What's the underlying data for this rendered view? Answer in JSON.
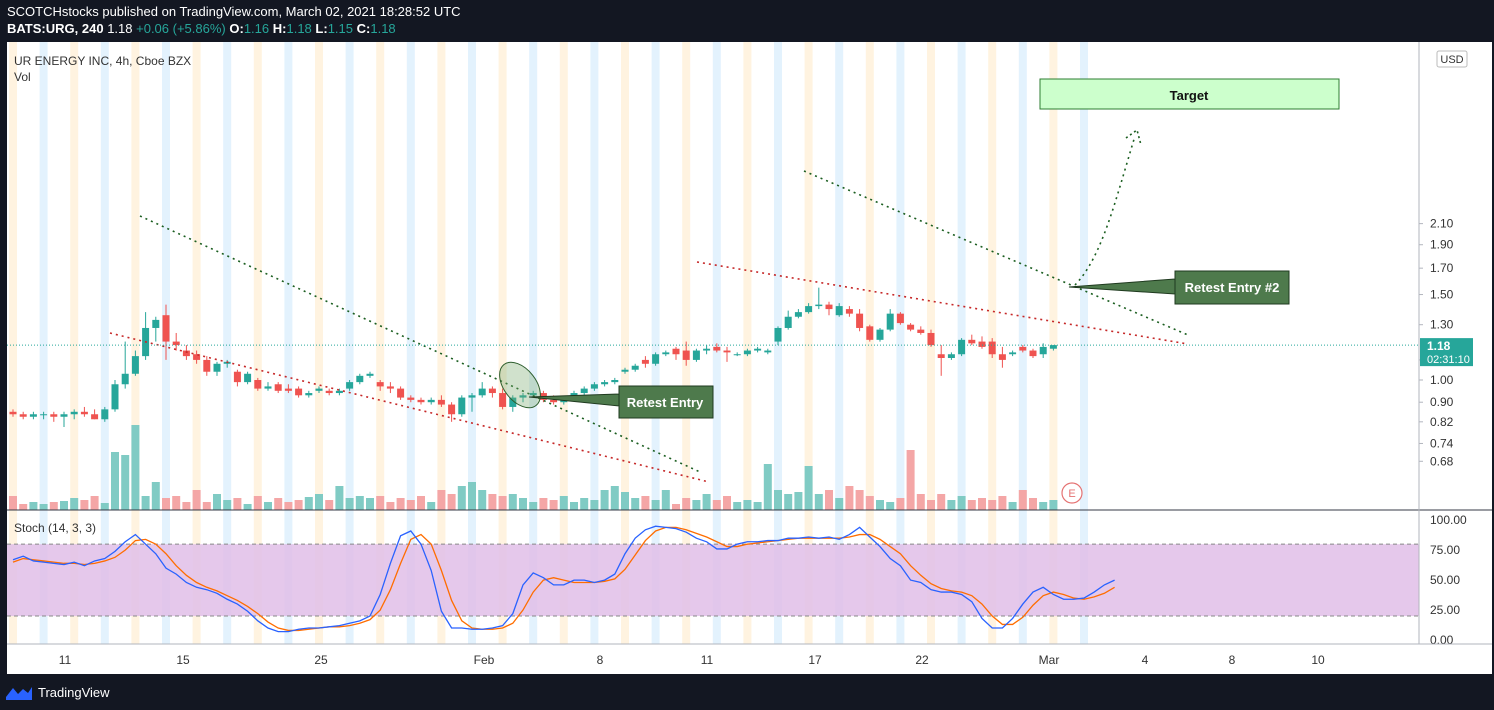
{
  "header": {
    "line1": "SCOTCHstocks published on TradingView.com, March 02, 2021 18:28:52 UTC",
    "symbol": "BATS:URG, 240",
    "last": "1.18",
    "change": "+0.06 (+5.86%)",
    "o_label": "O:",
    "o": "1.16",
    "h_label": "H:",
    "h": "1.18",
    "l_label": "L:",
    "l": "1.15",
    "c_label": "C:",
    "c": "1.18"
  },
  "legend": {
    "title": "UR ENERGY INC, 4h, Cboe BZX",
    "vol": "Vol",
    "stoch": "Stoch (14, 3, 3)"
  },
  "currency": "USD",
  "price_badge": {
    "price": "1.18",
    "countdown": "02:31:10"
  },
  "annotations": {
    "target": "Target",
    "retest1": "Retest Entry",
    "retest2": "Retest Entry #2",
    "earnings": "E"
  },
  "footer": {
    "brand": "TradingView"
  },
  "colors": {
    "up": "#26a69a",
    "down": "#ef5350",
    "stoch_k": "#2962ff",
    "stoch_d": "#ff6d00",
    "band": "#e1bee7",
    "target_fill": "#ccffcc"
  },
  "chart_data": {
    "type": "candlestick",
    "x_ticks": [
      "11",
      "15",
      "25",
      "Feb",
      "8",
      "11",
      "17",
      "22",
      "Mar",
      "4",
      "8",
      "10"
    ],
    "y_ticks": [
      "2.10",
      "1.90",
      "1.70",
      "1.50",
      "1.30",
      "1.18",
      "1.10",
      "1.00",
      "0.90",
      "0.82",
      "0.74",
      "0.68"
    ],
    "y_scale": "log",
    "stoch_ticks": [
      "100.00",
      "75.00",
      "50.00",
      "25.00",
      "0.00"
    ],
    "stoch_band": [
      20,
      80
    ],
    "last_price": 1.18,
    "candles": [
      {
        "o": 0.86,
        "h": 0.87,
        "l": 0.84,
        "c": 0.85
      },
      {
        "o": 0.85,
        "h": 0.86,
        "l": 0.83,
        "c": 0.84
      },
      {
        "o": 0.84,
        "h": 0.86,
        "l": 0.83,
        "c": 0.85
      },
      {
        "o": 0.85,
        "h": 0.86,
        "l": 0.83,
        "c": 0.85
      },
      {
        "o": 0.85,
        "h": 0.86,
        "l": 0.82,
        "c": 0.84
      },
      {
        "o": 0.84,
        "h": 0.86,
        "l": 0.8,
        "c": 0.85
      },
      {
        "o": 0.85,
        "h": 0.87,
        "l": 0.83,
        "c": 0.86
      },
      {
        "o": 0.86,
        "h": 0.88,
        "l": 0.84,
        "c": 0.85
      },
      {
        "o": 0.85,
        "h": 0.87,
        "l": 0.83,
        "c": 0.83
      },
      {
        "o": 0.83,
        "h": 0.88,
        "l": 0.82,
        "c": 0.87
      },
      {
        "o": 0.87,
        "h": 1.0,
        "l": 0.86,
        "c": 0.98
      },
      {
        "o": 0.98,
        "h": 1.2,
        "l": 0.96,
        "c": 1.03
      },
      {
        "o": 1.03,
        "h": 1.15,
        "l": 1.02,
        "c": 1.12
      },
      {
        "o": 1.12,
        "h": 1.38,
        "l": 1.1,
        "c": 1.28
      },
      {
        "o": 1.28,
        "h": 1.35,
        "l": 1.2,
        "c": 1.33
      },
      {
        "o": 1.36,
        "h": 1.43,
        "l": 1.1,
        "c": 1.2
      },
      {
        "o": 1.2,
        "h": 1.25,
        "l": 1.15,
        "c": 1.18
      },
      {
        "o": 1.15,
        "h": 1.18,
        "l": 1.1,
        "c": 1.12
      },
      {
        "o": 1.13,
        "h": 1.15,
        "l": 1.08,
        "c": 1.1
      },
      {
        "o": 1.1,
        "h": 1.12,
        "l": 1.02,
        "c": 1.04
      },
      {
        "o": 1.04,
        "h": 1.09,
        "l": 1.02,
        "c": 1.08
      },
      {
        "o": 1.08,
        "h": 1.1,
        "l": 1.06,
        "c": 1.09
      },
      {
        "o": 1.04,
        "h": 1.05,
        "l": 0.97,
        "c": 0.99
      },
      {
        "o": 0.99,
        "h": 1.04,
        "l": 0.98,
        "c": 1.03
      },
      {
        "o": 1.0,
        "h": 1.01,
        "l": 0.95,
        "c": 0.96
      },
      {
        "o": 0.96,
        "h": 0.99,
        "l": 0.95,
        "c": 0.97
      },
      {
        "o": 0.98,
        "h": 0.99,
        "l": 0.94,
        "c": 0.95
      },
      {
        "o": 0.96,
        "h": 0.98,
        "l": 0.94,
        "c": 0.95
      },
      {
        "o": 0.96,
        "h": 0.97,
        "l": 0.92,
        "c": 0.93
      },
      {
        "o": 0.93,
        "h": 0.95,
        "l": 0.92,
        "c": 0.94
      },
      {
        "o": 0.95,
        "h": 0.97,
        "l": 0.94,
        "c": 0.96
      },
      {
        "o": 0.95,
        "h": 0.96,
        "l": 0.93,
        "c": 0.94
      },
      {
        "o": 0.94,
        "h": 0.96,
        "l": 0.93,
        "c": 0.95
      },
      {
        "o": 0.96,
        "h": 1.0,
        "l": 0.95,
        "c": 0.99
      },
      {
        "o": 0.99,
        "h": 1.03,
        "l": 0.98,
        "c": 1.02
      },
      {
        "o": 1.02,
        "h": 1.04,
        "l": 1.01,
        "c": 1.03
      },
      {
        "o": 0.99,
        "h": 1.0,
        "l": 0.95,
        "c": 0.97
      },
      {
        "o": 0.97,
        "h": 0.99,
        "l": 0.94,
        "c": 0.96
      },
      {
        "o": 0.96,
        "h": 0.97,
        "l": 0.91,
        "c": 0.92
      },
      {
        "o": 0.92,
        "h": 0.93,
        "l": 0.9,
        "c": 0.91
      },
      {
        "o": 0.91,
        "h": 0.92,
        "l": 0.89,
        "c": 0.9
      },
      {
        "o": 0.9,
        "h": 0.92,
        "l": 0.89,
        "c": 0.91
      },
      {
        "o": 0.91,
        "h": 0.93,
        "l": 0.88,
        "c": 0.89
      },
      {
        "o": 0.89,
        "h": 0.9,
        "l": 0.82,
        "c": 0.85
      },
      {
        "o": 0.85,
        "h": 0.93,
        "l": 0.84,
        "c": 0.92
      },
      {
        "o": 0.92,
        "h": 0.94,
        "l": 0.86,
        "c": 0.93
      },
      {
        "o": 0.93,
        "h": 0.99,
        "l": 0.92,
        "c": 0.96
      },
      {
        "o": 0.96,
        "h": 0.97,
        "l": 0.92,
        "c": 0.94
      },
      {
        "o": 0.94,
        "h": 0.96,
        "l": 0.87,
        "c": 0.88
      },
      {
        "o": 0.88,
        "h": 0.93,
        "l": 0.86,
        "c": 0.92
      },
      {
        "o": 0.92,
        "h": 0.94,
        "l": 0.9,
        "c": 0.93
      },
      {
        "o": 0.93,
        "h": 0.95,
        "l": 0.92,
        "c": 0.94
      },
      {
        "o": 0.94,
        "h": 0.95,
        "l": 0.9,
        "c": 0.91
      },
      {
        "o": 0.91,
        "h": 0.93,
        "l": 0.89,
        "c": 0.9
      },
      {
        "o": 0.9,
        "h": 0.92,
        "l": 0.89,
        "c": 0.91
      },
      {
        "o": 0.92,
        "h": 0.95,
        "l": 0.91,
        "c": 0.94
      },
      {
        "o": 0.94,
        "h": 0.97,
        "l": 0.93,
        "c": 0.96
      },
      {
        "o": 0.96,
        "h": 0.99,
        "l": 0.95,
        "c": 0.98
      },
      {
        "o": 0.98,
        "h": 1.0,
        "l": 0.97,
        "c": 0.99
      },
      {
        "o": 0.99,
        "h": 1.01,
        "l": 0.98,
        "c": 1.0
      },
      {
        "o": 1.04,
        "h": 1.06,
        "l": 1.03,
        "c": 1.05
      },
      {
        "o": 1.05,
        "h": 1.08,
        "l": 1.04,
        "c": 1.07
      },
      {
        "o": 1.1,
        "h": 1.12,
        "l": 1.06,
        "c": 1.08
      },
      {
        "o": 1.08,
        "h": 1.14,
        "l": 1.07,
        "c": 1.13
      },
      {
        "o": 1.13,
        "h": 1.15,
        "l": 1.12,
        "c": 1.14
      },
      {
        "o": 1.16,
        "h": 1.17,
        "l": 1.1,
        "c": 1.13
      },
      {
        "o": 1.15,
        "h": 1.2,
        "l": 1.07,
        "c": 1.1
      },
      {
        "o": 1.1,
        "h": 1.16,
        "l": 1.09,
        "c": 1.15
      },
      {
        "o": 1.15,
        "h": 1.18,
        "l": 1.13,
        "c": 1.16
      },
      {
        "o": 1.17,
        "h": 1.19,
        "l": 1.14,
        "c": 1.15
      },
      {
        "o": 1.15,
        "h": 1.17,
        "l": 1.09,
        "c": 1.14
      },
      {
        "o": 1.13,
        "h": 1.14,
        "l": 1.12,
        "c": 1.13
      },
      {
        "o": 1.13,
        "h": 1.16,
        "l": 1.12,
        "c": 1.15
      },
      {
        "o": 1.15,
        "h": 1.17,
        "l": 1.14,
        "c": 1.16
      },
      {
        "o": 1.14,
        "h": 1.16,
        "l": 1.13,
        "c": 1.15
      },
      {
        "o": 1.2,
        "h": 1.29,
        "l": 1.18,
        "c": 1.28
      },
      {
        "o": 1.28,
        "h": 1.39,
        "l": 1.27,
        "c": 1.35
      },
      {
        "o": 1.35,
        "h": 1.4,
        "l": 1.34,
        "c": 1.38
      },
      {
        "o": 1.38,
        "h": 1.44,
        "l": 1.37,
        "c": 1.42
      },
      {
        "o": 1.42,
        "h": 1.55,
        "l": 1.4,
        "c": 1.43
      },
      {
        "o": 1.43,
        "h": 1.45,
        "l": 1.36,
        "c": 1.4
      },
      {
        "o": 1.36,
        "h": 1.44,
        "l": 1.35,
        "c": 1.42
      },
      {
        "o": 1.4,
        "h": 1.42,
        "l": 1.35,
        "c": 1.37
      },
      {
        "o": 1.37,
        "h": 1.4,
        "l": 1.26,
        "c": 1.28
      },
      {
        "o": 1.29,
        "h": 1.3,
        "l": 1.2,
        "c": 1.21
      },
      {
        "o": 1.21,
        "h": 1.28,
        "l": 1.2,
        "c": 1.27
      },
      {
        "o": 1.27,
        "h": 1.4,
        "l": 1.26,
        "c": 1.37
      },
      {
        "o": 1.37,
        "h": 1.38,
        "l": 1.3,
        "c": 1.31
      },
      {
        "o": 1.3,
        "h": 1.31,
        "l": 1.26,
        "c": 1.27
      },
      {
        "o": 1.27,
        "h": 1.29,
        "l": 1.24,
        "c": 1.25
      },
      {
        "o": 1.25,
        "h": 1.27,
        "l": 1.17,
        "c": 1.18
      },
      {
        "o": 1.13,
        "h": 1.18,
        "l": 1.02,
        "c": 1.11
      },
      {
        "o": 1.11,
        "h": 1.14,
        "l": 1.1,
        "c": 1.13
      },
      {
        "o": 1.13,
        "h": 1.22,
        "l": 1.12,
        "c": 1.21
      },
      {
        "o": 1.21,
        "h": 1.24,
        "l": 1.18,
        "c": 1.19
      },
      {
        "o": 1.2,
        "h": 1.23,
        "l": 1.16,
        "c": 1.17
      },
      {
        "o": 1.2,
        "h": 1.22,
        "l": 1.11,
        "c": 1.13
      },
      {
        "o": 1.13,
        "h": 1.17,
        "l": 1.06,
        "c": 1.1
      },
      {
        "o": 1.13,
        "h": 1.15,
        "l": 1.12,
        "c": 1.14
      },
      {
        "o": 1.17,
        "h": 1.18,
        "l": 1.14,
        "c": 1.15
      },
      {
        "o": 1.15,
        "h": 1.16,
        "l": 1.11,
        "c": 1.12
      },
      {
        "o": 1.13,
        "h": 1.19,
        "l": 1.11,
        "c": 1.17
      },
      {
        "o": 1.16,
        "h": 1.18,
        "l": 1.15,
        "c": 1.18
      }
    ],
    "volume": [
      14,
      6,
      8,
      6,
      8,
      9,
      12,
      10,
      14,
      7,
      58,
      55,
      85,
      14,
      28,
      12,
      14,
      8,
      20,
      8,
      16,
      10,
      12,
      6,
      14,
      8,
      12,
      8,
      10,
      13,
      16,
      10,
      24,
      12,
      14,
      12,
      14,
      8,
      12,
      10,
      14,
      8,
      20,
      16,
      24,
      28,
      20,
      16,
      14,
      16,
      12,
      8,
      12,
      10,
      14,
      8,
      12,
      10,
      20,
      24,
      18,
      12,
      14,
      10,
      20,
      6,
      12,
      10,
      16,
      10,
      14,
      8,
      10,
      8,
      46,
      20,
      16,
      18,
      44,
      16,
      20,
      12,
      24,
      20,
      14,
      10,
      8,
      12,
      60,
      16,
      10,
      16,
      10,
      14,
      10,
      12,
      10,
      14,
      8,
      20,
      12,
      8,
      10,
      8,
      10,
      6
    ],
    "stoch_k": [
      67,
      70,
      66,
      65,
      64,
      63,
      65,
      62,
      66,
      68,
      74,
      82,
      88,
      80,
      72,
      60,
      55,
      48,
      44,
      42,
      39,
      34,
      30,
      24,
      16,
      10,
      7,
      7,
      9,
      10,
      10,
      11,
      12,
      14,
      16,
      20,
      38,
      64,
      87,
      91,
      80,
      58,
      24,
      10,
      10,
      9,
      9,
      10,
      12,
      22,
      46,
      56,
      52,
      46,
      46,
      50,
      50,
      48,
      50,
      55,
      72,
      85,
      92,
      95,
      94,
      93,
      90,
      85,
      82,
      76,
      76,
      80,
      82,
      82,
      83,
      83,
      85,
      85,
      86,
      85,
      86,
      84,
      88,
      94,
      86,
      78,
      68,
      62,
      50,
      48,
      42,
      40,
      40,
      38,
      32,
      18,
      10,
      10,
      18,
      30,
      40,
      44,
      38,
      34,
      34,
      35,
      40,
      46,
      50
    ],
    "stoch_d": [
      65,
      68,
      67,
      66,
      65,
      64,
      64,
      63,
      64,
      66,
      69,
      75,
      83,
      84,
      80,
      72,
      62,
      54,
      48,
      44,
      41,
      37,
      33,
      28,
      22,
      15,
      10,
      8,
      8,
      9,
      10,
      11,
      11,
      12,
      14,
      17,
      25,
      42,
      64,
      84,
      88,
      80,
      58,
      33,
      16,
      10,
      9,
      9,
      10,
      14,
      25,
      40,
      50,
      52,
      50,
      48,
      48,
      48,
      49,
      51,
      59,
      71,
      83,
      91,
      94,
      94,
      92,
      89,
      86,
      82,
      78,
      78,
      80,
      81,
      82,
      83,
      84,
      85,
      85,
      85,
      85,
      85,
      86,
      88,
      88,
      84,
      78,
      72,
      62,
      54,
      47,
      43,
      41,
      40,
      37,
      30,
      20,
      13,
      13,
      19,
      29,
      37,
      40,
      38,
      35,
      34,
      36,
      39,
      44
    ]
  }
}
